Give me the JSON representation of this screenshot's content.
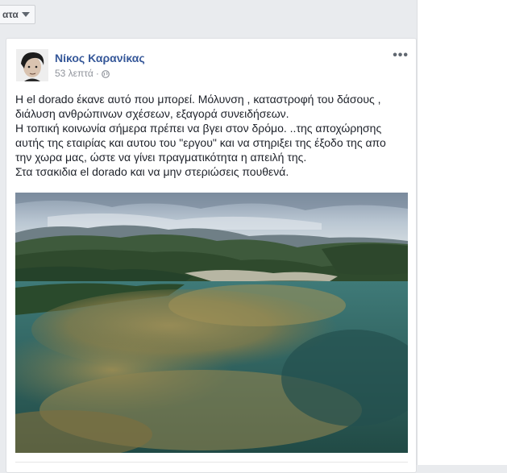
{
  "top_bar": {
    "dropdown_label": "ατα"
  },
  "post": {
    "author": "Νίκος Καρανίκας",
    "time": "53 λεπτά",
    "separator": "·",
    "privacy_icon": "globe-icon",
    "more_icon": "ellipsis-icon",
    "more_label": "•••",
    "lines": [
      "Η el dorado έκανε αυτό που μπορεί. Μόλυνση , καταστροφή του δάσους ,",
      "διάλυση ανθρώπινων σχέσεων, εξαγορά συνειδήσεων.",
      "Η τοπική κοινωνία σήμερα πρέπει να βγει στον δρόμο. ..της αποχώρησης",
      "αυτής της εταιρίας και αυτου του \"εργου\" και να στηριξει της έξοδο της απο",
      "την χωρα μας, ώστε να γίνει πραγματικότητα η απειλή της.",
      "Στα τσακιδια el dorado και να μην στεριώσεις πουθενά."
    ]
  },
  "colors": {
    "link_blue": "#365899",
    "page_bg": "#e9ebee",
    "text": "#1d2129",
    "meta_gray": "#90949c"
  }
}
